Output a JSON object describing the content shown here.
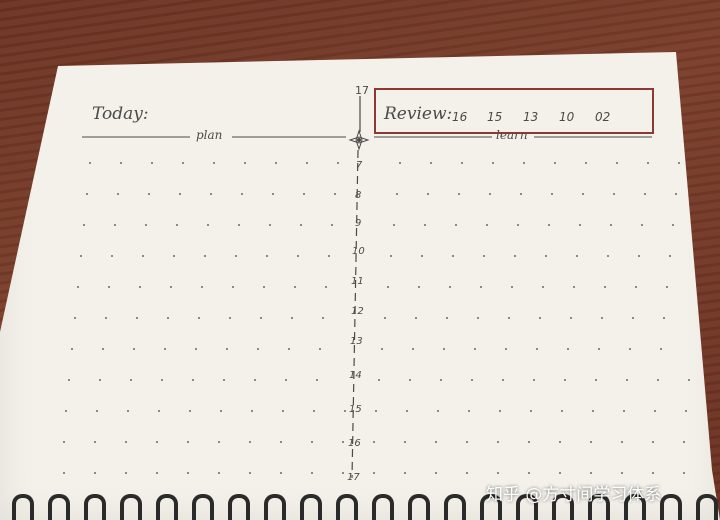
{
  "left_page": {
    "title": "Today:",
    "section_label": "plan"
  },
  "right_page": {
    "title": "Review:",
    "review_days": [
      "16",
      "15",
      "13",
      "10",
      "02"
    ],
    "section_label": "learn"
  },
  "timeline": {
    "top_hour": "17",
    "hours": [
      "7",
      "8",
      "9",
      "10",
      "11",
      "12",
      "13",
      "14",
      "15",
      "16",
      "17"
    ]
  },
  "watermark": "知乎 @方寸间学习体系",
  "colors": {
    "paper": "#f3f1ea",
    "ink": "#4a4a48",
    "highlight_box": "#8a3a33",
    "desk": "#6b3322"
  }
}
